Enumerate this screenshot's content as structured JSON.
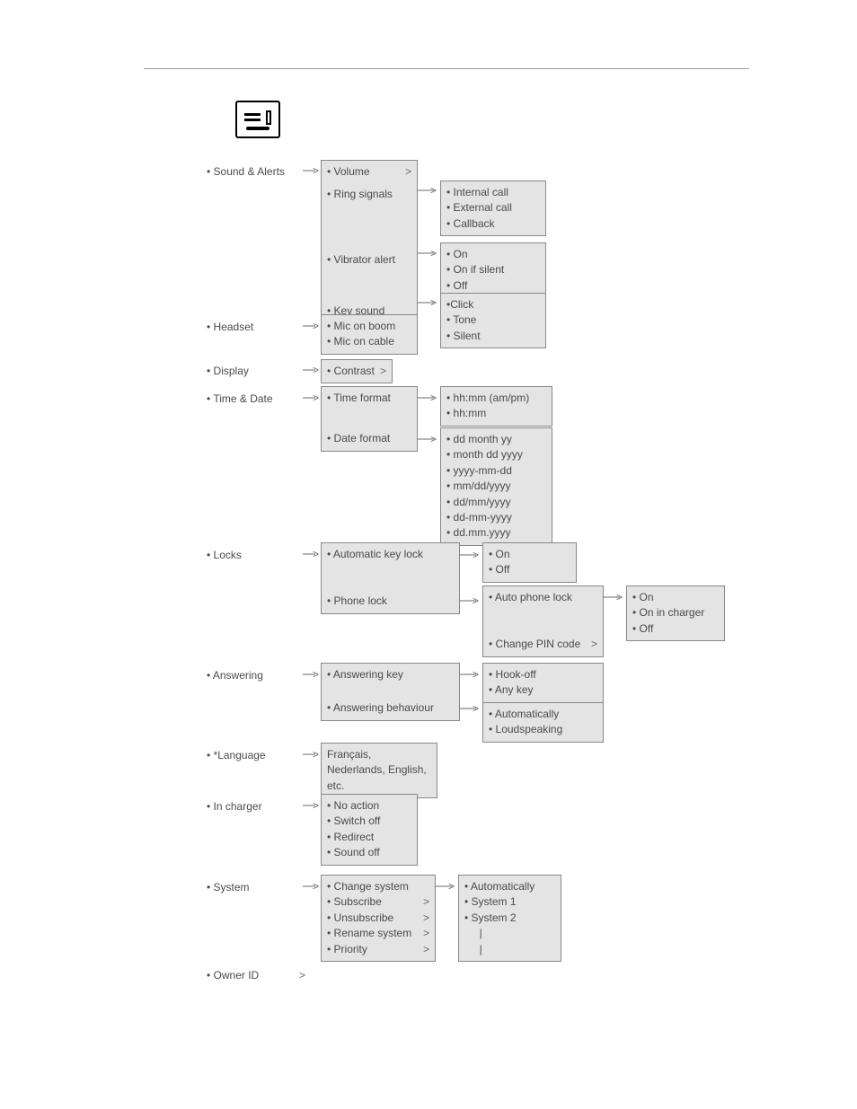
{
  "root": {
    "sound_alerts": "• Sound & Alerts",
    "headset": "• Headset",
    "display": "• Display",
    "time_date": "• Time & Date",
    "locks": "• Locks",
    "answering": "• Answering",
    "language": "• *Language",
    "in_charger": "• In charger",
    "system": "• System",
    "owner_id": "• Owner ID"
  },
  "sound_alerts_sub": {
    "volume": "• Volume",
    "ring_signals": "• Ring signals",
    "vibrator_alert": "• Vibrator alert",
    "key_sound": "• Key sound"
  },
  "ring_signals_opts": {
    "a": "• Internal call",
    "b": "• External call",
    "c": "• Callback"
  },
  "vibrator_opts": {
    "a": "• On",
    "b": "• On if silent",
    "c": "• Off"
  },
  "key_sound_opts": {
    "a": "•Click",
    "b": "• Tone",
    "c": "• Silent"
  },
  "headset_sub": {
    "a": "• Mic on boom",
    "b": "• Mic on cable"
  },
  "display_sub": {
    "a": "• Contrast"
  },
  "time_date_sub": {
    "time_format": "• Time format",
    "date_format": "• Date format"
  },
  "time_format_opts": {
    "a": "• hh:mm (am/pm)",
    "b": "• hh:mm"
  },
  "date_format_opts": {
    "a": "• dd month yy",
    "b": "• month dd yyyy",
    "c": "• yyyy-mm-dd",
    "d": "• mm/dd/yyyy",
    "e": "• dd/mm/yyyy",
    "f": "• dd-mm-yyyy",
    "g": "• dd.mm.yyyy"
  },
  "locks_sub": {
    "auto_key_lock": "• Automatic key lock",
    "phone_lock": "• Phone lock"
  },
  "auto_key_lock_opts": {
    "a": "• On",
    "b": "• Off"
  },
  "phone_lock_opts": {
    "a": "• Auto phone lock",
    "b": "• Change PIN code"
  },
  "auto_phone_lock_opts": {
    "a": "• On",
    "b": "• On in charger",
    "c": "• Off"
  },
  "answering_sub": {
    "answering_key": "• Answering key",
    "answering_behaviour": "• Answering behaviour"
  },
  "answering_key_opts": {
    "a": "• Hook-off",
    "b": "• Any key"
  },
  "answering_behaviour_opts": {
    "a": "• Automatically",
    "b": "• Loudspeaking"
  },
  "language_opts": {
    "a": "Français, Nederlands, English, etc."
  },
  "in_charger_opts": {
    "a": "• No action",
    "b": "• Switch off",
    "c": "• Redirect",
    "d": "• Sound off"
  },
  "system_sub": {
    "a": "• Change system",
    "b": "• Subscribe",
    "c": "• Unsubscribe",
    "d": "• Rename system",
    "e": "• Priority"
  },
  "change_system_opts": {
    "a": "• Automatically",
    "b": "• System 1",
    "c": "• System 2",
    "d": "     |",
    "e": "     |"
  },
  "glyph": {
    "chev": ">",
    "arrow": ">"
  }
}
